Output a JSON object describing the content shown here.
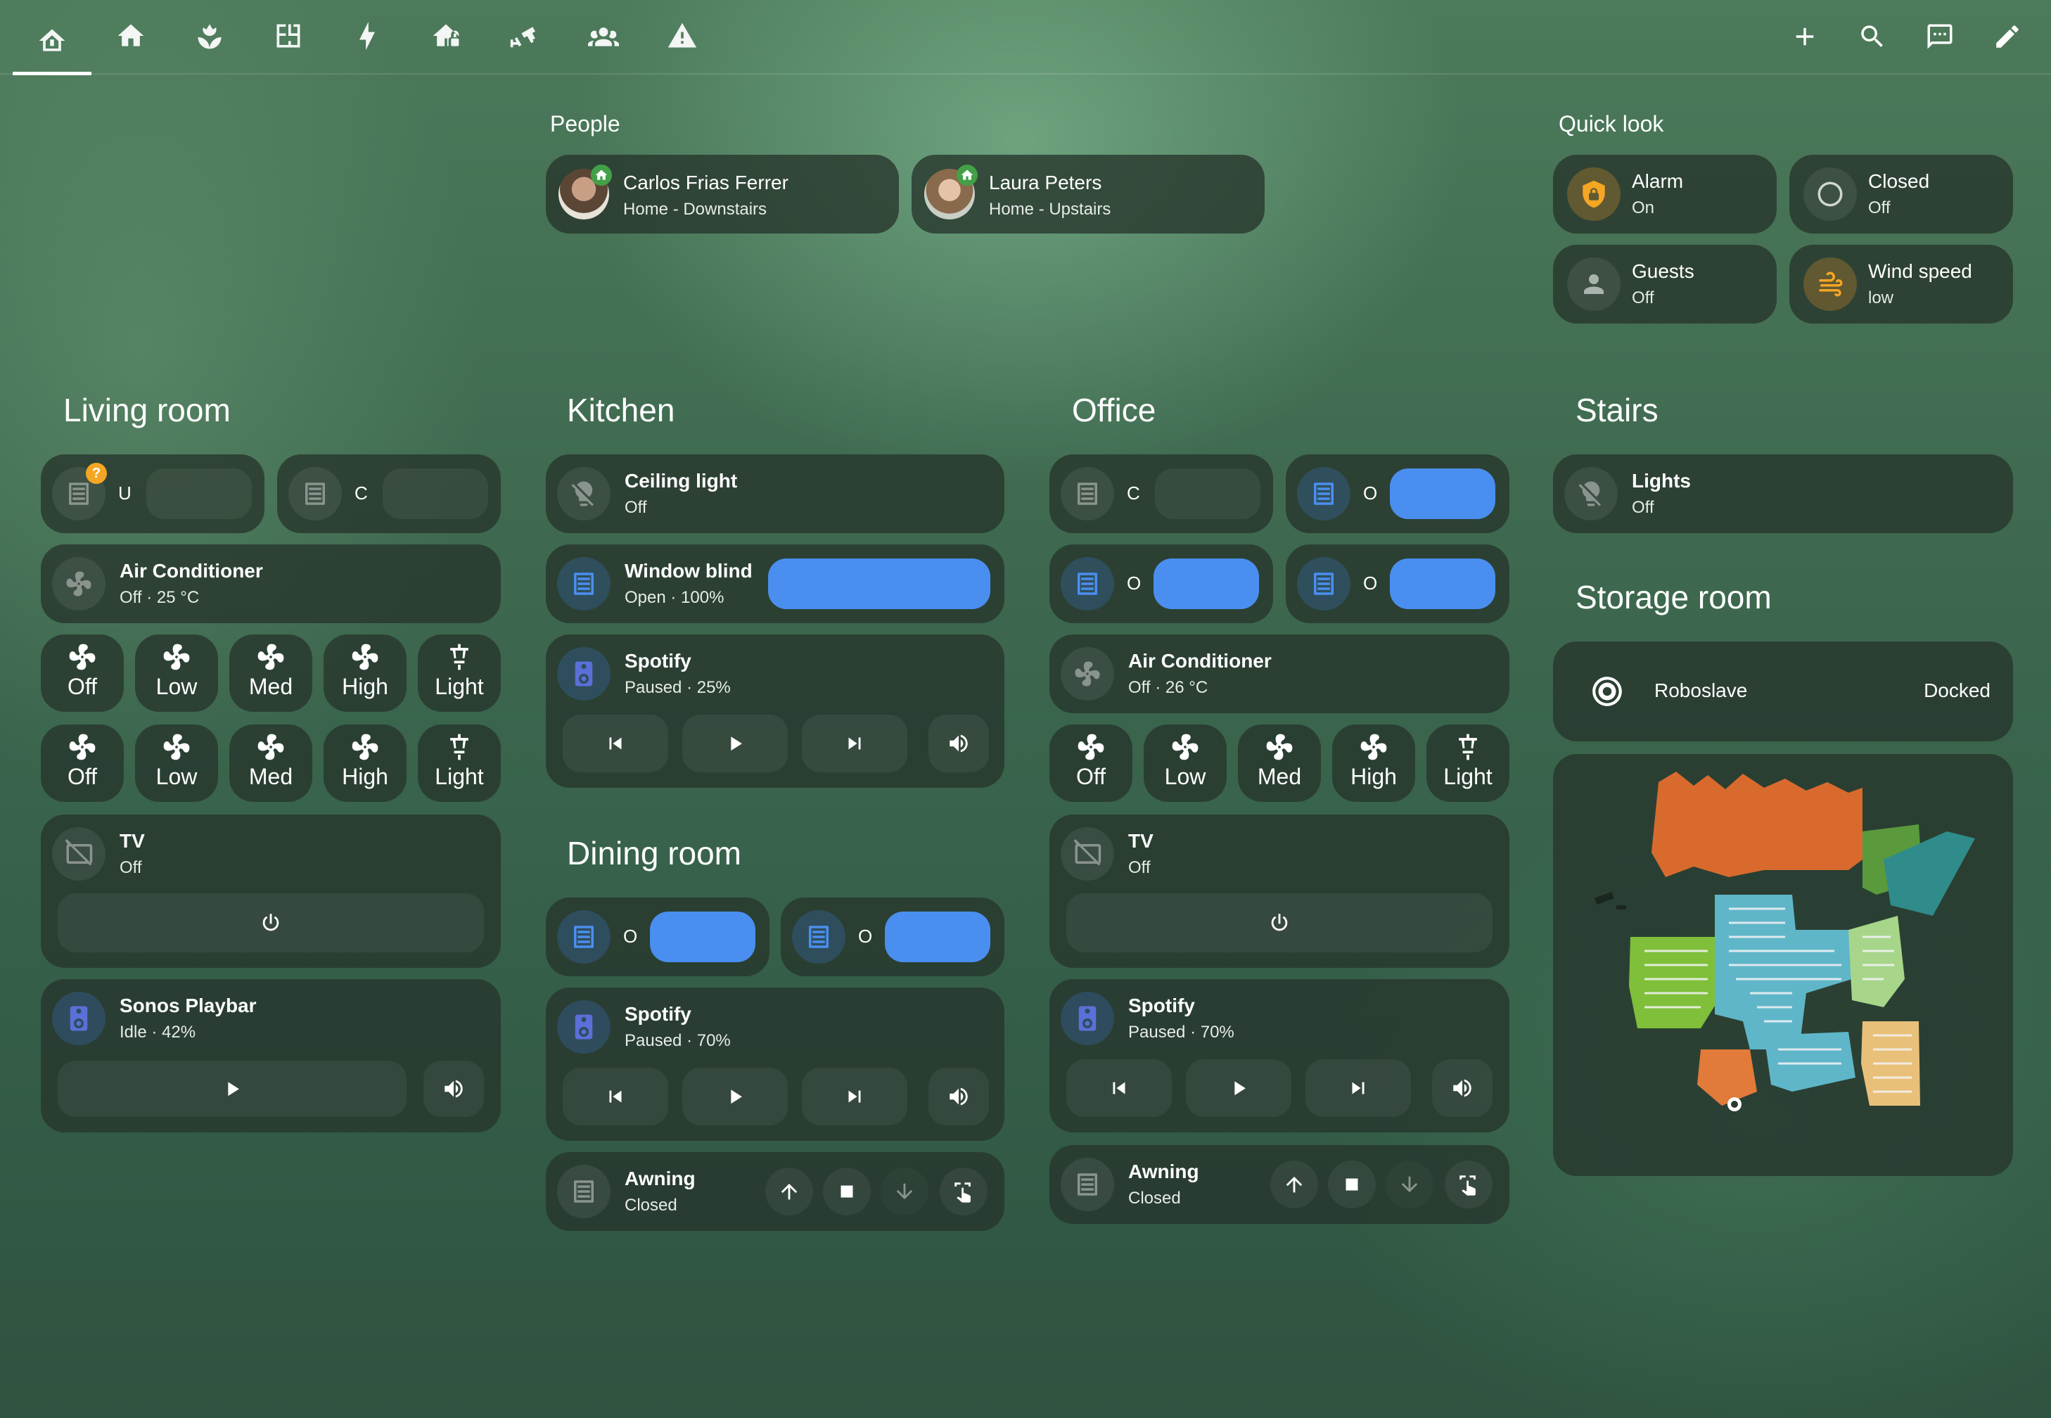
{
  "nav": {
    "tabs": [
      {
        "name": "home-dashboard"
      },
      {
        "name": "house"
      },
      {
        "name": "garden"
      },
      {
        "name": "floorplan"
      },
      {
        "name": "energy"
      },
      {
        "name": "security"
      },
      {
        "name": "cameras"
      },
      {
        "name": "people"
      },
      {
        "name": "alerts"
      }
    ],
    "active": 0
  },
  "people": {
    "title": "People",
    "items": [
      {
        "name": "Carlos Frias Ferrer",
        "state": "Home - Downstairs"
      },
      {
        "name": "Laura Peters",
        "state": "Home - Upstairs"
      }
    ]
  },
  "quick_look": {
    "title": "Quick look",
    "items": [
      {
        "name": "Alarm",
        "state": "On"
      },
      {
        "name": "Closed",
        "state": "Off"
      },
      {
        "name": "Guests",
        "state": "Off"
      },
      {
        "name": "Wind speed",
        "state": "low"
      }
    ]
  },
  "living_room": {
    "title": "Living room",
    "covers": [
      {
        "letter": "U",
        "position": 0
      },
      {
        "letter": "C",
        "position": 0
      }
    ],
    "ac": {
      "name": "Air Conditioner",
      "state": "Off · 25 °C"
    },
    "fan_modes": [
      "Off",
      "Low",
      "Med",
      "High",
      "Light"
    ],
    "tv": {
      "name": "TV",
      "state": "Off"
    },
    "media": {
      "name": "Sonos Playbar",
      "state": "Idle · 42%"
    }
  },
  "kitchen": {
    "title": "Kitchen",
    "light": {
      "name": "Ceiling light",
      "state": "Off"
    },
    "blind": {
      "name": "Window blind",
      "state": "Open · 100%",
      "position": 100
    },
    "media": {
      "name": "Spotify",
      "state": "Paused · 25%"
    }
  },
  "dining_room": {
    "title": "Dining room",
    "covers": [
      {
        "letter": "O",
        "position": 100
      },
      {
        "letter": "O",
        "position": 100
      }
    ],
    "media": {
      "name": "Spotify",
      "state": "Paused · 70%"
    },
    "awning": {
      "name": "Awning",
      "state": "Closed"
    }
  },
  "office": {
    "title": "Office",
    "covers": [
      {
        "letter": "C",
        "position": 0
      },
      {
        "letter": "O",
        "position": 100
      },
      {
        "letter": "O",
        "position": 100
      },
      {
        "letter": "O",
        "position": 100
      }
    ],
    "ac": {
      "name": "Air Conditioner",
      "state": "Off · 26 °C"
    },
    "fan_modes": [
      "Off",
      "Low",
      "Med",
      "High",
      "Light"
    ],
    "tv": {
      "name": "TV",
      "state": "Off"
    },
    "media": {
      "name": "Spotify",
      "state": "Paused · 70%"
    },
    "awning": {
      "name": "Awning",
      "state": "Closed"
    }
  },
  "stairs": {
    "title": "Stairs",
    "light": {
      "name": "Lights",
      "state": "Off"
    }
  },
  "storage_room": {
    "title": "Storage room",
    "vacuum": {
      "name": "Roboslave",
      "state": "Docked"
    }
  },
  "colors": {
    "accent_blue": "#4a8fef",
    "alarm_orange": "#f5a623",
    "presence_green": "#43a047"
  }
}
